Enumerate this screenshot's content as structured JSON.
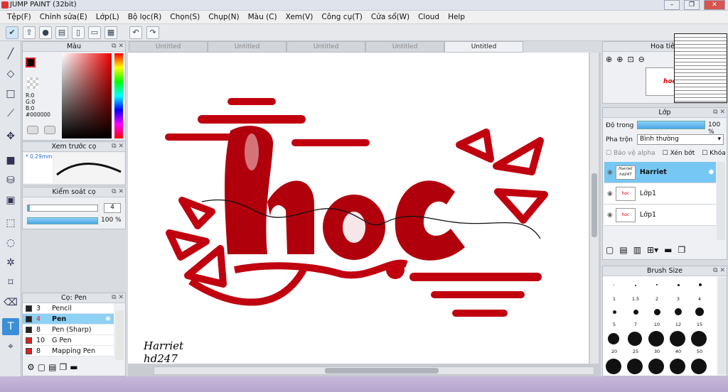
{
  "app": {
    "title": "JUMP PAINT (32bit)"
  },
  "menu": [
    "Tệp(F)",
    "Chỉnh sửa(E)",
    "Lớp(L)",
    "Bộ lọc(R)",
    "Chọn(S)",
    "Chụp(N)",
    "Màu (C)",
    "Xem(V)",
    "Công cụ(T)",
    "Cửa sổ(W)",
    "Cloud",
    "Help"
  ],
  "color_panel": {
    "title": "Màu",
    "r": "R:0",
    "g": "G:0",
    "b": "B:0",
    "hex": "#000000",
    "current": "#000000"
  },
  "brush_preview": {
    "title": "Xem trước cọ",
    "size": "0.29mm"
  },
  "brush_control": {
    "title": "Kiểm soát cọ",
    "size_value": "4",
    "opacity_value": "100 %"
  },
  "brush_list": {
    "title": "Cọ: Pen",
    "items": [
      {
        "size": "3",
        "name": "Pencil",
        "color": "#222222"
      },
      {
        "size": "4",
        "name": "Pen",
        "color": "#222222",
        "selected": true
      },
      {
        "size": "8",
        "name": "Pen (Sharp)",
        "color": "#222222"
      },
      {
        "size": "10",
        "name": "G Pen",
        "color": "#dd2222"
      },
      {
        "size": "8",
        "name": "Mapping Pen",
        "color": "#dd2222"
      }
    ]
  },
  "tabs": [
    "Untitled",
    "Untitled",
    "Untitled",
    "Untitled",
    "Untitled"
  ],
  "canvas": {
    "artwork_text": "hoc",
    "signature_line1": "Harriet",
    "signature_line2": "hd247",
    "accent": "#c0000f"
  },
  "navigator": {
    "title": "Hoa tiêu"
  },
  "layers": {
    "title": "Lớp",
    "opacity_label": "Độ trong",
    "opacity_value": "100 %",
    "blend_label": "Pha trộn",
    "blend_value": "Bình thường",
    "protect_alpha": "Bảo vệ alpha",
    "clipping": "Xén bớt",
    "lock": "Khóa",
    "items": [
      {
        "name": "Harriet",
        "thumb": "Harriet hd247",
        "selected": true
      },
      {
        "name": "Lớp1",
        "thumb": "hoc"
      },
      {
        "name": "Lớp1",
        "thumb": "hoc"
      }
    ]
  },
  "brush_size": {
    "title": "Brush Size",
    "labels": [
      "1",
      "1.5",
      "2",
      "3",
      "4",
      "5",
      "7",
      "10",
      "12",
      "15",
      "20",
      "25",
      "30",
      "40",
      "50"
    ]
  }
}
